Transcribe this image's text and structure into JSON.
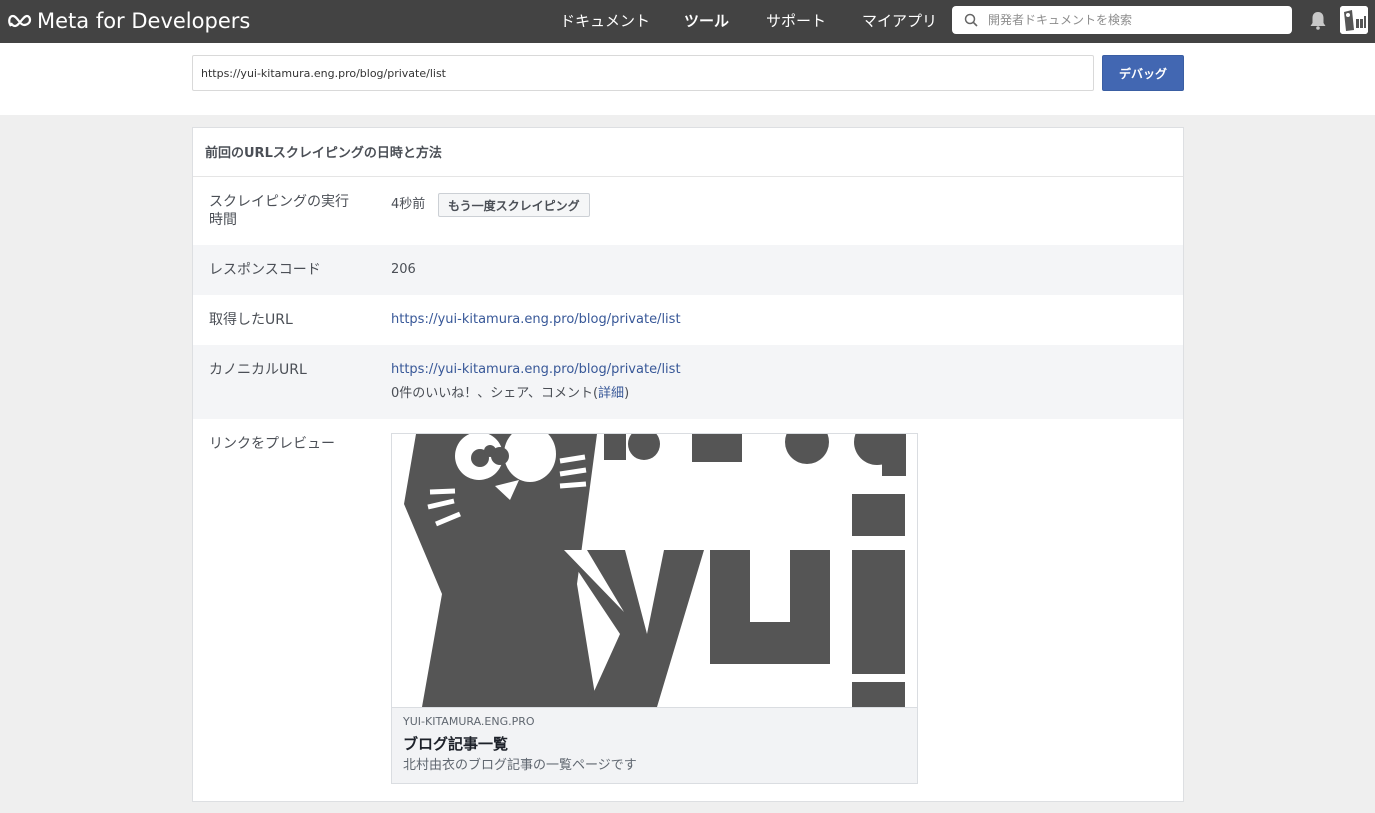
{
  "brand": {
    "name": "Meta for Developers"
  },
  "nav": {
    "items": [
      {
        "label": "ドキュメント",
        "active": false
      },
      {
        "label": "ツール",
        "active": true
      },
      {
        "label": "サポート",
        "active": false
      },
      {
        "label": "マイアプリ",
        "active": false
      }
    ],
    "search_placeholder": "開発者ドキュメントを検索"
  },
  "url_bar": {
    "value": "https://yui-kitamura.eng.pro/blog/private/list",
    "debug_label": "デバッグ"
  },
  "card": {
    "title": "前回のURLスクレイピングの日時と方法",
    "rows": {
      "scrape_time": {
        "label_line1": "スクレイピングの実行",
        "label_line2": "時間",
        "value": "4秒前",
        "button": "もう一度スクレイピング"
      },
      "response_code": {
        "label": "レスポンスコード",
        "value": "206"
      },
      "fetched_url": {
        "label": "取得したURL",
        "value": "https://yui-kitamura.eng.pro/blog/private/list"
      },
      "canonical_url": {
        "label": "カノニカルURL",
        "value": "https://yui-kitamura.eng.pro/blog/private/list",
        "engagement_prefix": "0件のいいね！、シェア、コメント(",
        "details_link": "詳細",
        "engagement_suffix": ")"
      },
      "link_preview": {
        "label": "リンクをプレビュー"
      }
    }
  },
  "preview": {
    "domain": "YUI-KITAMURA.ENG.PRO",
    "title": "ブログ記事一覧",
    "description": "北村由衣のブログ記事の一覧ページです"
  },
  "colors": {
    "topbar": "#434343",
    "primary": "#4267b2",
    "link": "#385898",
    "logo_gray": "#555555"
  }
}
